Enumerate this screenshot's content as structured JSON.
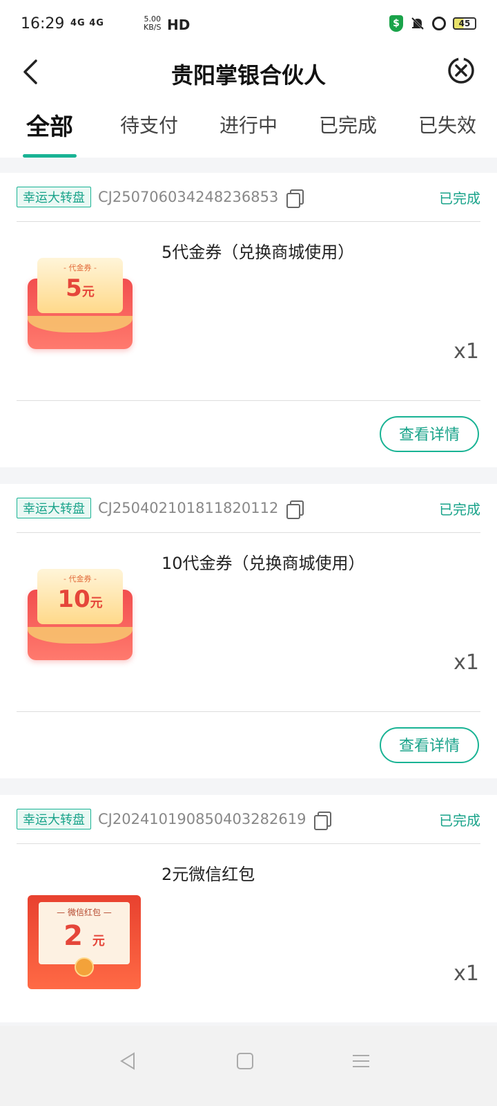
{
  "status_bar": {
    "time": "16:29",
    "network": "4G 4G",
    "speed_top": "5.00",
    "speed_bottom": "KB/S",
    "hd": "HD",
    "battery": "45"
  },
  "header": {
    "title": "贵阳掌银合伙人"
  },
  "tabs": [
    {
      "label": "全部",
      "active": true
    },
    {
      "label": "待支付",
      "active": false
    },
    {
      "label": "进行中",
      "active": false
    },
    {
      "label": "已完成",
      "active": false
    },
    {
      "label": "已失效",
      "active": false
    }
  ],
  "orders": [
    {
      "tag": "幸运大转盘",
      "order_no": "CJ250706034248236853",
      "status": "已完成",
      "product": "5代金券（兑换商城使用）",
      "qty": "x1",
      "thumb_caption": "- 代金券 -",
      "thumb_value": "5",
      "thumb_unit": "元",
      "detail_button": "查看详情"
    },
    {
      "tag": "幸运大转盘",
      "order_no": "CJ250402101811820112",
      "status": "已完成",
      "product": "10代金券（兑换商城使用）",
      "qty": "x1",
      "thumb_caption": "- 代金券 -",
      "thumb_value": "10",
      "thumb_unit": "元",
      "detail_button": "查看详情"
    },
    {
      "tag": "幸运大转盘",
      "order_no": "CJ20241019085040328​2619",
      "status": "已完成",
      "product": "2元微信红包",
      "qty": "x1",
      "thumb_caption": "— 微信红包 —",
      "thumb_value": "2",
      "thumb_unit": "元"
    }
  ],
  "colors": {
    "accent": "#19b394",
    "accent_text": "#19a38a",
    "background": "#f4f5f7"
  }
}
